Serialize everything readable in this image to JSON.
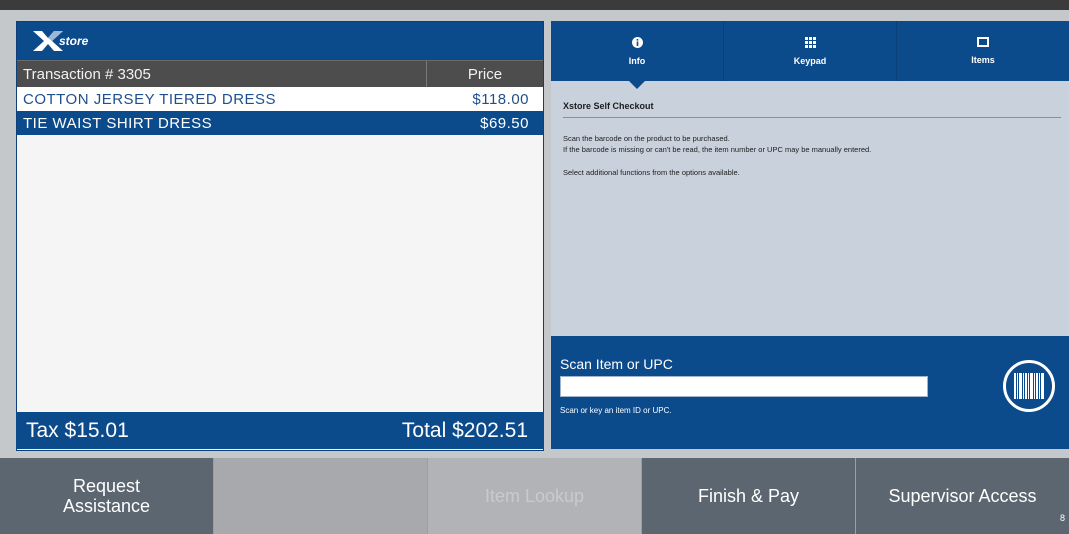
{
  "brand": {
    "logo_text": "store"
  },
  "transaction": {
    "header_label": "Transaction # 3305",
    "price_header": "Price",
    "items": [
      {
        "name": "COTTON JERSEY TIERED DRESS",
        "price": "$118.00",
        "selected": false
      },
      {
        "name": "TIE WAIST SHIRT DRESS",
        "price": "$69.50",
        "selected": true
      }
    ],
    "tax": "Tax $15.01",
    "total": "Total $202.51"
  },
  "tabs": [
    {
      "label": "Info",
      "icon": "info-icon",
      "active": true
    },
    {
      "label": "Keypad",
      "icon": "keypad-icon",
      "active": false
    },
    {
      "label": "Items",
      "icon": "items-icon",
      "active": false
    }
  ],
  "info": {
    "title": "Xstore Self Checkout",
    "line1": "Scan the barcode on the product to be purchased.",
    "line2": "If the barcode is missing or can't be read, the item number or UPC may be manually entered.",
    "line3": "Select additional functions from the options available."
  },
  "scan": {
    "label": "Scan Item or UPC",
    "value": "",
    "hint": "Scan or key an item ID or UPC."
  },
  "buttons": {
    "request_assistance": "Request Assistance",
    "item_lookup": "Item Lookup",
    "finish_pay": "Finish & Pay",
    "supervisor_access": "Supervisor Access",
    "corner_tag": "8"
  },
  "colors": {
    "primary_blue": "#0b4a8b",
    "header_gray": "#4d4d4d",
    "button_dark": "#5b6670",
    "button_light": "#a7a9ac"
  }
}
